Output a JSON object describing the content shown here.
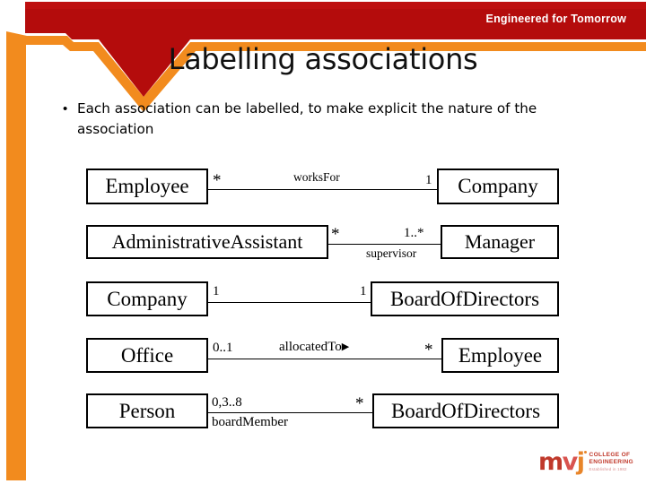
{
  "header": {
    "tagline": "Engineered for Tomorrow",
    "title": "Labelling associations",
    "banner_color": "#b40c0c",
    "accent_color": "#f28b1e"
  },
  "bullets": [
    {
      "marker": "•",
      "text": "Each association can be labelled, to make explicit the nature of the association"
    }
  ],
  "diagram": {
    "type": "uml-class-associations",
    "rows": [
      {
        "left_class": "Employee",
        "right_class": "Company",
        "left_mult": "*",
        "right_mult": "1",
        "label": "worksFor",
        "label_position": "above",
        "arrow": ""
      },
      {
        "left_class": "AdministrativeAssistant",
        "right_class": "Manager",
        "left_mult": "*",
        "right_mult": "1..*",
        "label": "supervisor",
        "label_position": "below",
        "arrow": ""
      },
      {
        "left_class": "Company",
        "right_class": "BoardOfDirectors",
        "left_mult": "1",
        "right_mult": "1",
        "label": "",
        "label_position": "above",
        "arrow": ""
      },
      {
        "left_class": "Office",
        "right_class": "Employee",
        "left_mult": "0..1",
        "right_mult": "*",
        "label": "allocatedTo",
        "label_position": "above",
        "arrow": "▶"
      },
      {
        "left_class": "Person",
        "right_class": "BoardOfDirectors",
        "left_mult": "0,3..8",
        "right_mult": "*",
        "label": "boardMember",
        "label_position": "below",
        "arrow": ""
      }
    ]
  },
  "logo": {
    "mark_m": "m",
    "mark_v": "v",
    "mark_j": "j",
    "line1": "COLLEGE OF",
    "line2": "ENGINEERING",
    "line3": "Established in 1982"
  }
}
